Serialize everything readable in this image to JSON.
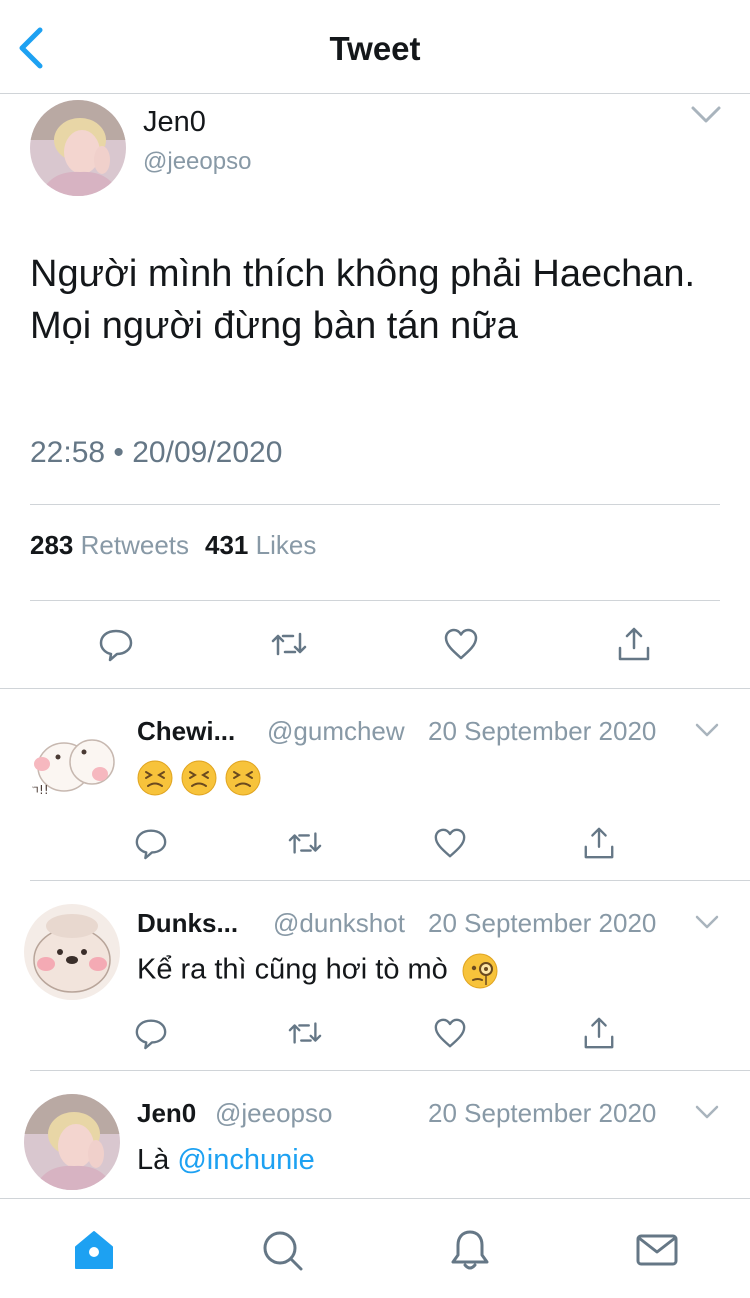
{
  "header": {
    "title": "Tweet"
  },
  "main_tweet": {
    "name": "Jen0",
    "handle": "@jeeopso",
    "text": "Người mình thích không phải Haechan. Mọi người đừng bàn tán nữa",
    "timestamp": "22:58 • 20/09/2020",
    "retweets_count": "283",
    "retweets_label": "Retweets",
    "likes_count": "431",
    "likes_label": "Likes"
  },
  "replies": [
    {
      "name": "Chewi...",
      "handle": "@gumchew",
      "date": "20 September 2020",
      "text": ""
    },
    {
      "name": "Dunks...",
      "handle": "@dunkshot",
      "date": "20 September 2020",
      "text": "Kể ra thì cũng hơi tò mò"
    },
    {
      "name": "Jen0",
      "handle": "@jeeopso",
      "date": "20 September 2020",
      "text_prefix": "Là",
      "mention": "@inchunie"
    }
  ],
  "icons": {
    "back": "chevron-left-icon",
    "reply": "speech-bubble-icon",
    "retweet": "retweet-icon",
    "like": "heart-icon",
    "share": "share-icon",
    "home": "home-icon",
    "search": "search-icon",
    "notifications": "bell-icon",
    "messages": "mail-icon"
  },
  "colors": {
    "accent": "#1da1f2",
    "text": "#14171a",
    "secondary": "#8899a6",
    "icon": "#657786",
    "divider": "#d0d4d8"
  }
}
